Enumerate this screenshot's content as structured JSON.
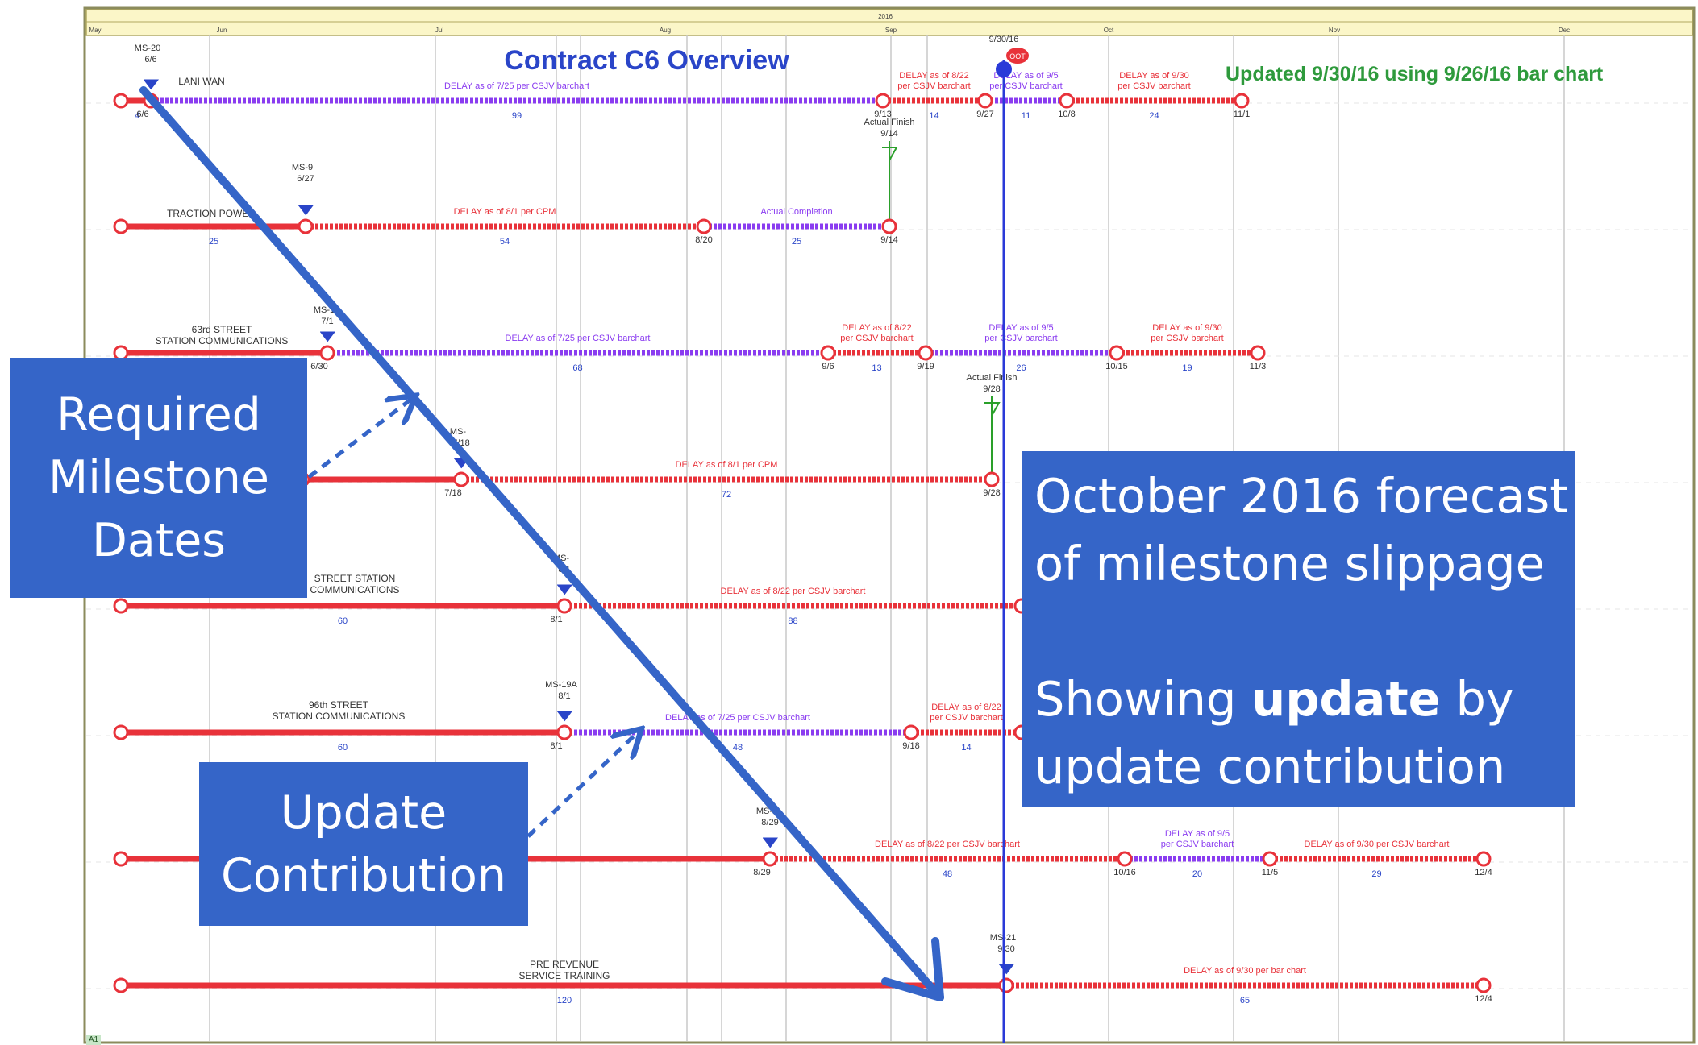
{
  "header": {
    "year": "2016",
    "months": [
      "May",
      "Jun",
      "Jul",
      "Aug",
      "Sep",
      "Oct",
      "Nov",
      "Dec"
    ]
  },
  "title": "Contract C6 Overview",
  "updated_note": "Updated 9/30/16 using 9/26/16 bar chart",
  "today_marker": "9/30/16",
  "flag_badge": "OOT",
  "callouts": {
    "required_milestones": [
      "Required",
      "Milestone",
      "Dates"
    ],
    "update_contribution": [
      "Update",
      "Contribution"
    ],
    "forecast": {
      "line1": "October 2016 forecast",
      "line2": "of milestone slippage",
      "line3_pre": "Showing ",
      "line3_bold": "update",
      "line3_post": " by",
      "line4": "update contribution"
    }
  },
  "footer_tag": "A1",
  "colors": {
    "red": "#e8323a",
    "purple": "#8a3cf0",
    "blue_line": "#2a3ad8",
    "callout": "#3565c8",
    "title": "#2a45c8",
    "updated": "#2e9a3c",
    "green": "#2aa02a"
  },
  "chart_data": {
    "type": "gantt",
    "rows": [
      {
        "label": "LANI WAN",
        "milestone": {
          "name": "MS-20",
          "date": "6/6"
        },
        "start_label": "6/6",
        "start_sub": "4",
        "segments": [
          {
            "kind": "purple",
            "label": "DELAY as of 7/25 per CSJV barchart",
            "days": "99",
            "end": "9/13"
          },
          {
            "kind": "red",
            "label": "DELAY as of 8/22 per CSJV barchart",
            "days": "14",
            "end": "9/27"
          },
          {
            "kind": "purple",
            "label": "DELAY as of 9/5 per CSJV barchart",
            "days": "11",
            "end": "10/8"
          },
          {
            "kind": "red",
            "label": "DELAY as of 9/30 per CSJV barchart",
            "days": "24",
            "end": "11/1"
          }
        ],
        "actual": {
          "label": "Actual Finish",
          "date": "9/14"
        }
      },
      {
        "label": "TRACTION POWER",
        "milestone": {
          "name": "MS-9",
          "date": "6/27"
        },
        "start_sub": "25",
        "segments": [
          {
            "kind": "red",
            "label": "DELAY as of 8/1 per CPM",
            "days": "54",
            "end": "8/20"
          },
          {
            "kind": "purple",
            "label": "Actual Completion",
            "days": "25",
            "end": "9/14"
          }
        ]
      },
      {
        "label": "63rd STREET STATION COMMUNICATIONS",
        "milestone": {
          "name": "MS-1",
          "date": "7/1"
        },
        "start_label": "6/30",
        "segments": [
          {
            "kind": "purple",
            "label": "DELAY as of 7/25 per CSJV barchart",
            "days": "68",
            "end": "9/6"
          },
          {
            "kind": "red",
            "label": "DELAY as of 8/22 per CSJV barchart",
            "days": "13",
            "end": "9/19"
          },
          {
            "kind": "purple",
            "label": "DELAY as of 9/5 per CSJV barchart",
            "days": "26",
            "end": "10/15"
          },
          {
            "kind": "red",
            "label": "DELAY as of 9/30 per CSJV barchart",
            "days": "19",
            "end": "11/3"
          }
        ],
        "actual": {
          "label": "Actual Finish",
          "date": "9/28"
        }
      },
      {
        "label": "",
        "milestone": {
          "name": "MS-",
          "date": "7/18"
        },
        "start_label": "7/18",
        "segments": [
          {
            "kind": "red",
            "label": "DELAY as of 8/1 per CPM",
            "days": "72",
            "end": "9/28"
          }
        ]
      },
      {
        "label": "STREET STATION COMMUNICATIONS",
        "milestone": {
          "name": "MS-",
          "date": "8/1"
        },
        "start_label": "8/1",
        "start_sub": "60",
        "segments": [
          {
            "kind": "red",
            "label": "DELAY as of 8/22 per CSJV barchart",
            "days": "88",
            "end": ""
          }
        ]
      },
      {
        "label": "96th STREET STATION COMMUNICATIONS",
        "milestone": {
          "name": "MS-19A",
          "date": "8/1"
        },
        "start_label": "8/1",
        "start_sub": "60",
        "segments": [
          {
            "kind": "purple",
            "label": "DELAY as of 7/25 per CSJV barchart",
            "days": "48",
            "end": "9/18"
          },
          {
            "kind": "red",
            "label": "DELAY as of 8/22 per CSJV barchart",
            "days": "14",
            "end": ""
          }
        ]
      },
      {
        "label": "",
        "milestone": {
          "name": "MS-1",
          "date": "8/29"
        },
        "start_label": "8/29",
        "segments": [
          {
            "kind": "red",
            "label": "DELAY as of 8/22 per CSJV barchart",
            "days": "48",
            "end": "10/16"
          },
          {
            "kind": "purple",
            "label": "DELAY as of 9/5 per CSJV barchart",
            "days": "20",
            "end": "11/5"
          },
          {
            "kind": "red",
            "label": "DELAY as of 9/30 per CSJV barchart",
            "days": "29",
            "end": "12/4"
          }
        ]
      },
      {
        "label": "PRE REVENUE SERVICE TRAINING",
        "milestone": {
          "name": "MS-21",
          "date": "9/30"
        },
        "start_sub": "120",
        "segments": [
          {
            "kind": "red",
            "label": "DELAY as of 9/30 per bar chart",
            "days": "65",
            "end": "12/4"
          }
        ]
      }
    ]
  }
}
